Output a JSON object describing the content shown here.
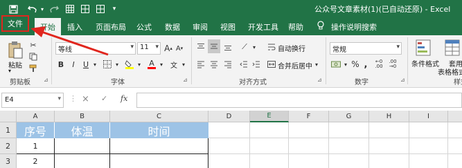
{
  "window": {
    "title": "公众号文章素材(1)(已自动还原)  -  Excel"
  },
  "quick_access": {
    "save_icon": "save-icon",
    "undo_icon": "undo-icon",
    "redo_icon": "redo-icon"
  },
  "tabs": {
    "file": "文件",
    "home": "开始",
    "insert": "插入",
    "layout": "页面布局",
    "formulas": "公式",
    "data": "数据",
    "review": "审阅",
    "view": "视图",
    "developer": "开发工具",
    "help": "帮助",
    "tell_me": "操作说明搜索"
  },
  "ribbon": {
    "clipboard": {
      "paste": "粘贴",
      "label": "剪贴板"
    },
    "font": {
      "name": "等线",
      "size": "11",
      "bold": "B",
      "italic": "I",
      "underline": "U",
      "label": "字体"
    },
    "alignment": {
      "wrap": "自动换行",
      "merge": "合并后居中",
      "label": "对齐方式"
    },
    "number": {
      "format": "常规",
      "percent": "%",
      "comma": ",",
      "label": "数字"
    },
    "styles": {
      "conditional": "条件格式",
      "table_format_1": "套用",
      "table_format_2": "表格格式",
      "label": "样式"
    }
  },
  "formula_bar": {
    "name_box": "E4",
    "cancel": "×",
    "enter": "✓",
    "fx": "fx",
    "content": ""
  },
  "grid": {
    "columns": [
      "A",
      "B",
      "C",
      "D",
      "E",
      "F",
      "G",
      "H",
      "I"
    ],
    "selected_column": "E",
    "rows": [
      "1",
      "2",
      "3"
    ],
    "header_row": [
      "序号",
      "体温",
      "时间"
    ],
    "data_rows": [
      [
        "1",
        "",
        ""
      ],
      [
        "2",
        "",
        ""
      ]
    ]
  },
  "colors": {
    "excel_green": "#217346",
    "header_fill": "#9dc3e6",
    "annotation_red": "#e0261e"
  }
}
